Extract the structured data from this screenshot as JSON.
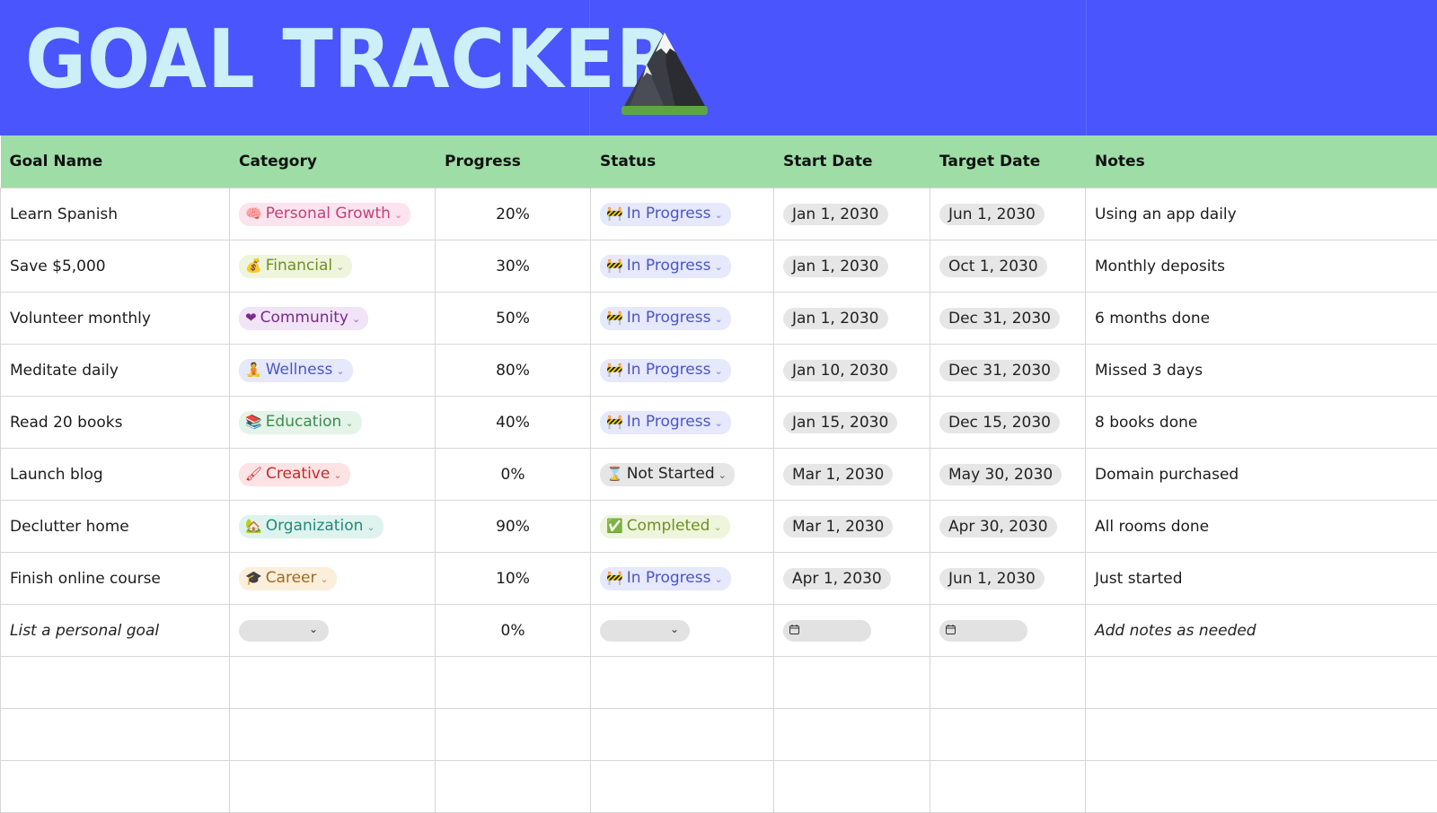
{
  "header": {
    "title": "GOAL TRACKER",
    "title_color": "#cdeff7",
    "background": "#4a55fe",
    "icon": "mountain-icon"
  },
  "table": {
    "columns": [
      "Goal Name",
      "Category",
      "Progress",
      "Status",
      "Start Date",
      "Target Date",
      "Notes"
    ],
    "rows": [
      {
        "goal": "Learn Spanish",
        "category": "Personal Growth",
        "category_icon": "brain-icon",
        "category_style": "pink",
        "progress": "20%",
        "status": "In Progress",
        "status_icon": "construction-icon",
        "status_style": "blue",
        "start": "Jan 1, 2030",
        "target": "Jun 1, 2030",
        "notes": "Using an app daily"
      },
      {
        "goal": "Save $5,000",
        "category": "Financial",
        "category_icon": "money-bag-icon",
        "category_style": "green",
        "progress": "30%",
        "status": "In Progress",
        "status_icon": "construction-icon",
        "status_style": "blue",
        "start": "Jan 1, 2030",
        "target": "Oct 1, 2030",
        "notes": "Monthly deposits"
      },
      {
        "goal": "Volunteer monthly",
        "category": "Community",
        "category_icon": "heart-icon",
        "category_style": "purple",
        "progress": "50%",
        "status": "In Progress",
        "status_icon": "construction-icon",
        "status_style": "blue",
        "start": "Jan 1, 2030",
        "target": "Dec 31, 2030",
        "notes": "6 months done"
      },
      {
        "goal": "Meditate daily",
        "category": "Wellness",
        "category_icon": "meditation-icon",
        "category_style": "indigo",
        "progress": "80%",
        "status": "In Progress",
        "status_icon": "construction-icon",
        "status_style": "blue",
        "start": "Jan 10, 2030",
        "target": "Dec 31, 2030",
        "notes": "Missed 3 days"
      },
      {
        "goal": "Read 20 books",
        "category": "Education",
        "category_icon": "books-icon",
        "category_style": "mint",
        "progress": "40%",
        "status": "In Progress",
        "status_icon": "construction-icon",
        "status_style": "blue",
        "start": "Jan 15, 2030",
        "target": "Dec 15, 2030",
        "notes": "8 books done"
      },
      {
        "goal": "Launch blog",
        "category": "Creative",
        "category_icon": "paintbrush-icon",
        "category_style": "red",
        "progress": "0%",
        "status": "Not Started",
        "status_icon": "hourglass-icon",
        "status_style": "gray",
        "start": "Mar 1, 2030",
        "target": "May 30, 2030",
        "notes": "Domain purchased"
      },
      {
        "goal": "Declutter home",
        "category": "Organization",
        "category_icon": "house-icon",
        "category_style": "teal",
        "progress": "90%",
        "status": "Completed",
        "status_icon": "check-icon",
        "status_style": "green",
        "start": "Mar 1, 2030",
        "target": "Apr 30, 2030",
        "notes": "All rooms done"
      },
      {
        "goal": "Finish online course",
        "category": "Career",
        "category_icon": "graduation-cap-icon",
        "category_style": "orange",
        "progress": "10%",
        "status": "In Progress",
        "status_icon": "construction-icon",
        "status_style": "blue",
        "start": "Apr 1, 2030",
        "target": "Jun 1, 2030",
        "notes": "Just started"
      }
    ],
    "placeholder_row": {
      "goal": "List a personal goal",
      "progress": "0%",
      "notes": "Add notes as needed"
    },
    "pill_styles": {
      "pink": {
        "bg": "#fbe4ee",
        "fg": "#c2407a"
      },
      "green": {
        "bg": "#eef5dc",
        "fg": "#6f8f22"
      },
      "purple": {
        "bg": "#f0e4f6",
        "fg": "#7b2a8c"
      },
      "indigo": {
        "bg": "#e6e8fb",
        "fg": "#4a56c8"
      },
      "mint": {
        "bg": "#e4f4e8",
        "fg": "#3c8c4e"
      },
      "red": {
        "bg": "#fde3e3",
        "fg": "#c22b2b"
      },
      "teal": {
        "bg": "#dff3ee",
        "fg": "#1f8a78"
      },
      "orange": {
        "bg": "#fbefdc",
        "fg": "#a0681c"
      },
      "blue": {
        "bg": "#e6e8fb",
        "fg": "#4a56c8"
      },
      "gray": {
        "bg": "#e6e6e6",
        "fg": "#222222"
      }
    },
    "header_bg": "#9edea6"
  }
}
